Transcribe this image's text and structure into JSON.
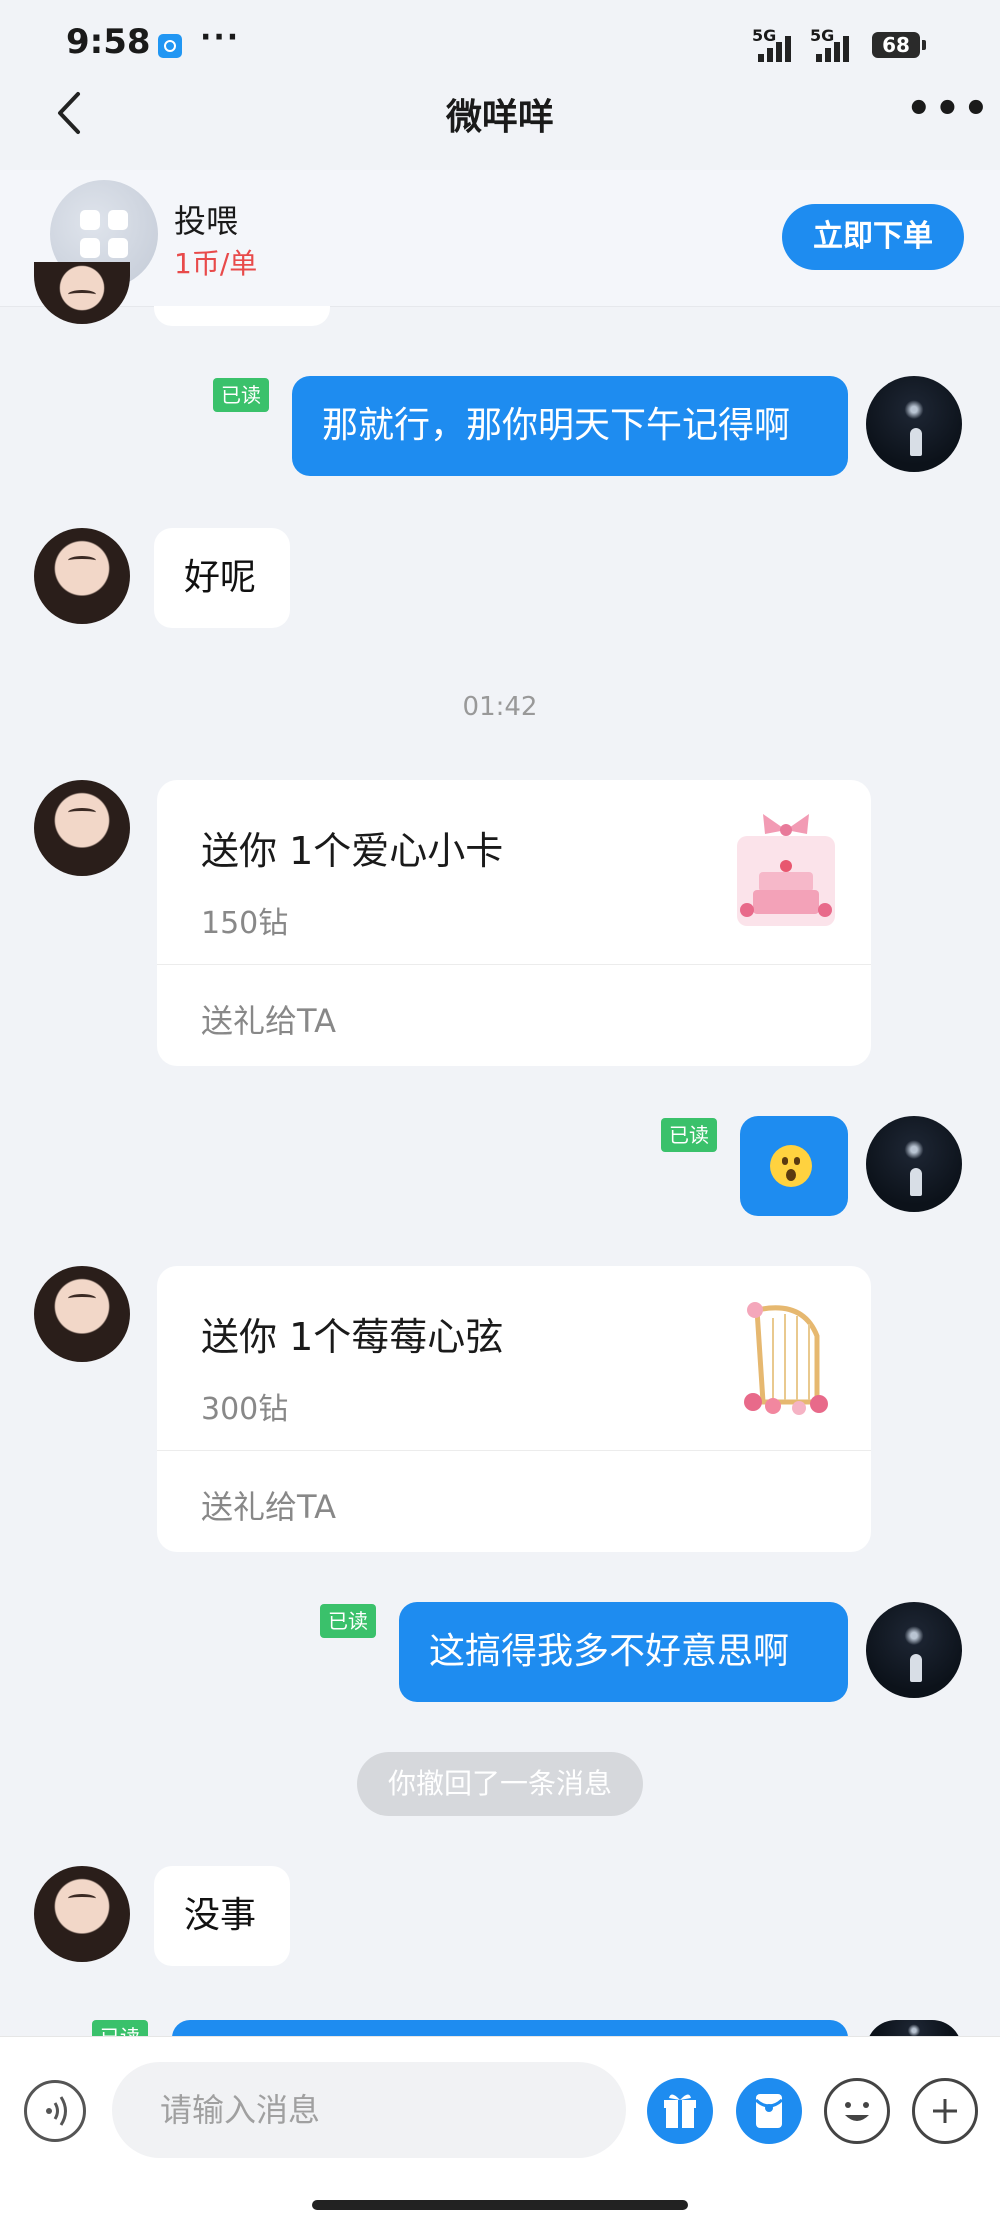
{
  "status": {
    "time": "9:58",
    "dots": "···",
    "net1": "5G",
    "net2": "5G",
    "battery": "68"
  },
  "nav": {
    "title": "微咩咩"
  },
  "service": {
    "name": "投喂",
    "price": "1币/单",
    "order_label": "立即下单"
  },
  "messages": {
    "m1": {
      "text": "那就行，那你明天下午记得啊",
      "read": "已读"
    },
    "m2": {
      "text": "好呢"
    },
    "ts1": "01:42",
    "gift1": {
      "title": "送你 1个爱心小卡",
      "price": "150钻",
      "action": "送礼给TA"
    },
    "m3": {
      "read": "已读"
    },
    "gift2": {
      "title": "送你 1个莓莓心弦",
      "price": "300钻",
      "action": "送礼给TA"
    },
    "m4": {
      "text": "这搞得我多不好意思啊",
      "read": "已读"
    },
    "recall": "你撤回了一条消息",
    "m5": {
      "text": "没事"
    },
    "m6": {
      "read": "已读"
    }
  },
  "input": {
    "placeholder": "请输入消息"
  },
  "colors": {
    "accent": "#1e8cf0",
    "read_badge": "#3ac16b",
    "price_red": "#e84a4a"
  }
}
